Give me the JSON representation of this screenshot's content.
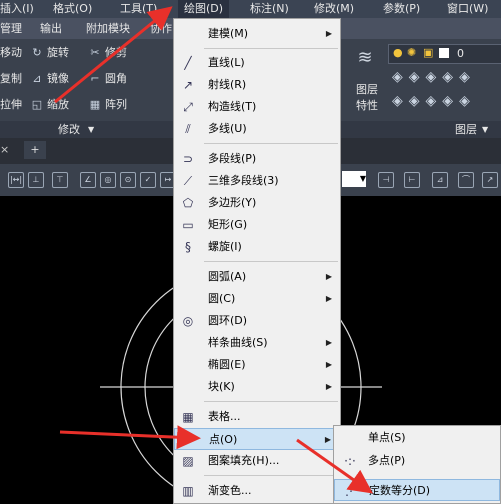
{
  "menubar": {
    "items": [
      "插入(I)",
      "格式(O)",
      "工具(T)",
      "绘图(D)",
      "标注(N)",
      "修改(M)",
      "参数(P)",
      "窗口(W)"
    ]
  },
  "tabs": [
    "管理",
    "输出",
    "附加模块",
    "协作"
  ],
  "ribbon": {
    "modify_tools": [
      "移动",
      "旋转",
      "修剪",
      "复制",
      "镜像",
      "圆角",
      "拉伸",
      "缩放",
      "阵列"
    ],
    "modify_panel": "修改",
    "layer_properties": [
      "图层",
      "特性"
    ],
    "layer_panel": "图层",
    "layer_value": "0"
  },
  "doc_tab_new": "+",
  "draw_menu": {
    "items": [
      {
        "label": "建模(M)",
        "submenu": true
      },
      {
        "label": "直线(L)"
      },
      {
        "label": "射线(R)"
      },
      {
        "label": "构造线(T)"
      },
      {
        "label": "多线(U)"
      },
      {
        "label": "多段线(P)"
      },
      {
        "label": "三维多段线(3)"
      },
      {
        "label": "多边形(Y)"
      },
      {
        "label": "矩形(G)"
      },
      {
        "label": "螺旋(I)"
      },
      {
        "label": "圆弧(A)",
        "submenu": true
      },
      {
        "label": "圆(C)",
        "submenu": true
      },
      {
        "label": "圆环(D)"
      },
      {
        "label": "样条曲线(S)",
        "submenu": true
      },
      {
        "label": "椭圆(E)",
        "submenu": true
      },
      {
        "label": "块(K)",
        "submenu": true
      },
      {
        "label": "表格..."
      },
      {
        "label": "点(O)",
        "submenu": true
      },
      {
        "label": "图案填充(H)..."
      },
      {
        "label": "渐变色..."
      }
    ]
  },
  "point_submenu": {
    "items": [
      "单点(S)",
      "多点(P)",
      "定数等分(D)"
    ]
  },
  "colors": {
    "menubar": "#3b4453",
    "menu_bg": "#f0f0f0",
    "highlight": "#cde3f5",
    "arrow": "#e8302a"
  },
  "icons": [
    "submenu-arrow-icon",
    "line-icon",
    "ray-icon",
    "polygon-icon",
    "rectangle-icon",
    "helix-icon",
    "donut-icon",
    "table-icon",
    "hatch-icon",
    "gradient-icon",
    "point-icon",
    "divide-icon"
  ]
}
